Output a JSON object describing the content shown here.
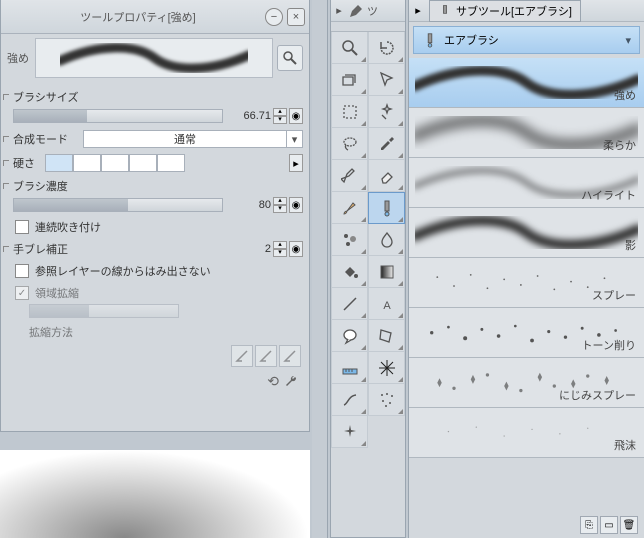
{
  "left": {
    "title": "ツールプロパティ[強め]",
    "preview_label": "強め",
    "brush_size_label": "ブラシサイズ",
    "brush_size_value": "66.71",
    "blend_label": "合成モード",
    "blend_value": "通常",
    "hardness_label": "硬さ",
    "density_label": "ブラシ濃度",
    "density_value": "80",
    "continuous_label": "連続吹き付け",
    "stabilize_label": "手ブレ補正",
    "stabilize_value": "2",
    "refline_label": "参照レイヤーの線からはみ出さない",
    "region_label": "領域拡縮",
    "method_label": "拡縮方法"
  },
  "toolbox": {
    "title": "ツ"
  },
  "right": {
    "tab_title": "サブツール[エアブラシ]",
    "category": "エアブラシ",
    "items": [
      {
        "label": "強め"
      },
      {
        "label": "柔らか"
      },
      {
        "label": "ハイライト"
      },
      {
        "label": "影"
      },
      {
        "label": "スプレー"
      },
      {
        "label": "トーン削り"
      },
      {
        "label": "にじみスプレー"
      },
      {
        "label": "飛沫"
      }
    ]
  }
}
